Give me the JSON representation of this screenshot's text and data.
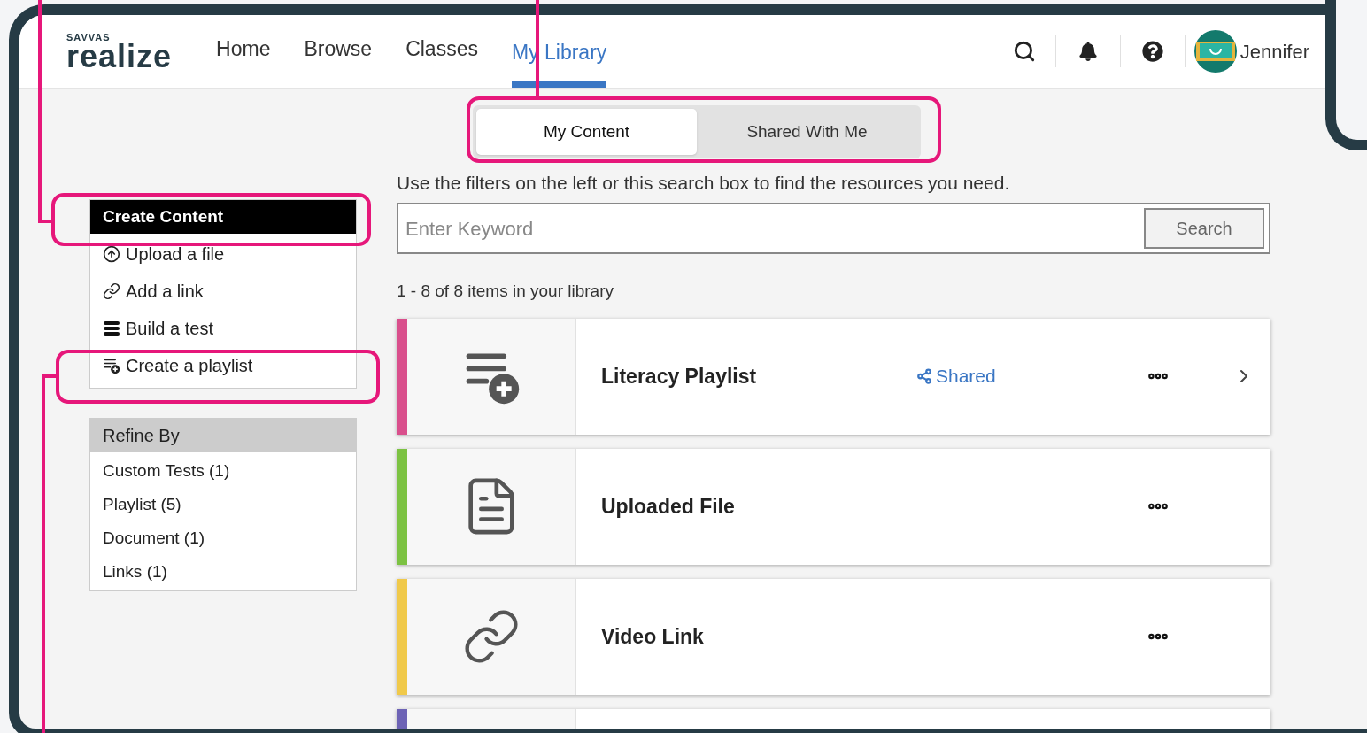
{
  "logo": {
    "brand": "SAVVAS",
    "product": "realize"
  },
  "nav": [
    {
      "label": "Home",
      "selected": false
    },
    {
      "label": "Browse",
      "selected": false
    },
    {
      "label": "Classes",
      "selected": false
    },
    {
      "label": "My Library",
      "selected": true
    }
  ],
  "user": {
    "name": "Jennifer"
  },
  "tabs": [
    {
      "label": "My Content",
      "selected": true
    },
    {
      "label": "Shared With Me",
      "selected": false
    }
  ],
  "create_content": {
    "title": "Create Content",
    "items": [
      {
        "kind": "upload",
        "label": "Upload a file"
      },
      {
        "kind": "link",
        "label": "Add a link"
      },
      {
        "kind": "test",
        "label": "Build a test"
      },
      {
        "kind": "playlist",
        "label": "Create a playlist"
      }
    ]
  },
  "refine_by": {
    "title": "Refine By",
    "items": [
      "Custom Tests (1)",
      "Playlist (5)",
      "Document (1)",
      "Links (1)"
    ]
  },
  "search": {
    "hint": "Use the filters on the left or this search box to find the resources you need.",
    "placeholder": "Enter Keyword",
    "button": "Search"
  },
  "count": "1 - 8 of 8 items in your library",
  "items": [
    {
      "kind": "playlist",
      "title": "Literacy Playlist",
      "color": "#d94f8c",
      "shared": "Shared",
      "chevron": true
    },
    {
      "kind": "document",
      "title": "Uploaded File",
      "color": "#7cc242"
    },
    {
      "kind": "link",
      "title": "Video Link",
      "color": "#f0c94a"
    },
    {
      "kind": "none",
      "color": "#6d63b5"
    }
  ]
}
